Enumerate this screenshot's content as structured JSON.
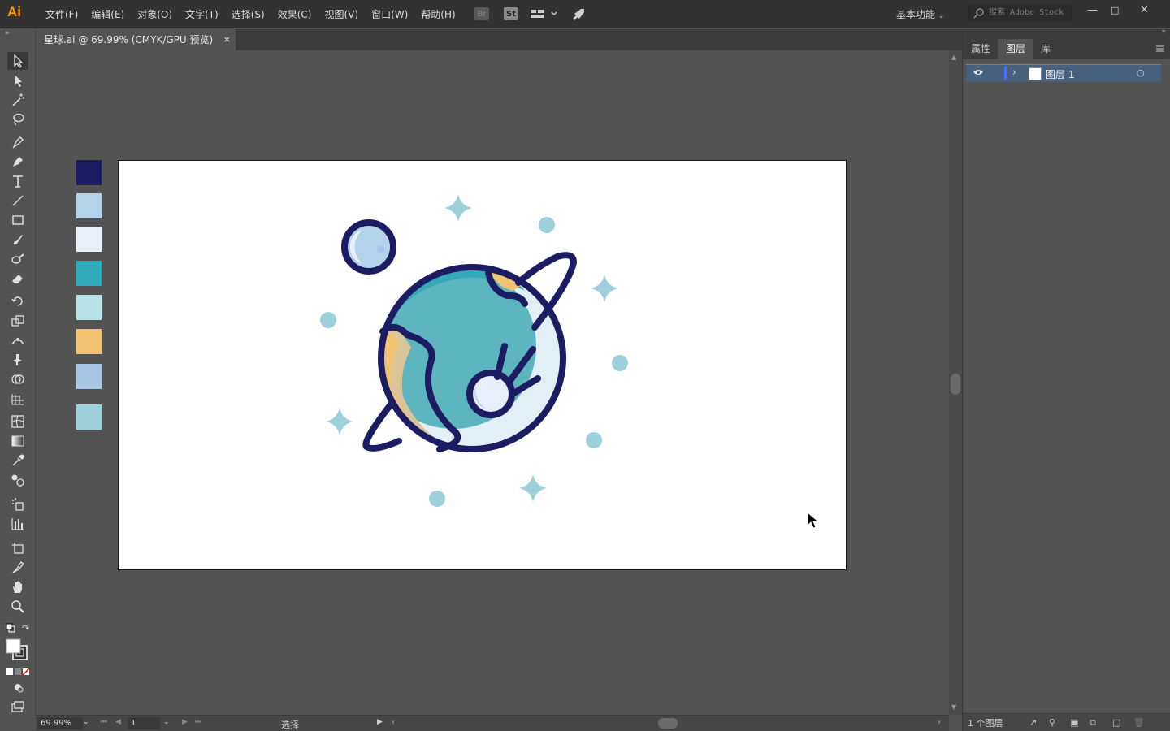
{
  "app": {
    "logo": "Ai"
  },
  "menu": [
    "文件(F)",
    "编辑(E)",
    "对象(O)",
    "文字(T)",
    "选择(S)",
    "效果(C)",
    "视图(V)",
    "窗口(W)",
    "帮助(H)"
  ],
  "menubar_icons": {
    "bridge": "Br",
    "stock": "St"
  },
  "workspace": {
    "label": "基本功能"
  },
  "stock_search": {
    "placeholder": "搜索 Adobe Stock"
  },
  "document_tab": {
    "title": "星球.ai @ 69.99% (CMYK/GPU 预览)",
    "close": "×"
  },
  "swatches": [
    "#1c1c63",
    "#b3d3ea",
    "#e9eefb",
    "#33aab9",
    "#b7e3e6",
    "#f2c273",
    "#a6c6e6",
    "#9dd0da"
  ],
  "artwork_colors": {
    "navy": "#1c1c63",
    "teal": "#33aab9",
    "blue_light": "#b3d3ea",
    "orange": "#f2c273",
    "star": "#9dd0da",
    "pale": "#e9eefb",
    "teal_light": "#b7e3e6"
  },
  "status": {
    "zoom": "69.99%",
    "page": "1",
    "tool_label": "选择"
  },
  "panel": {
    "tabs": [
      "属性",
      "图层",
      "库"
    ],
    "active_tab": "图层",
    "layers": [
      {
        "name": "图层 1"
      }
    ],
    "footer_count": "1 个图层"
  }
}
